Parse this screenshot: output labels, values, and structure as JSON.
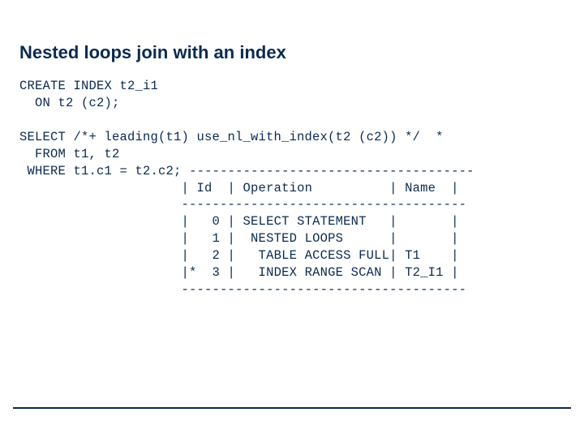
{
  "title": "Nested loops join with an index",
  "sql": {
    "line1": "CREATE INDEX t2_i1",
    "line2": "  ON t2 (c2);",
    "line3": "",
    "line4": "SELECT /*+ leading(t1) use_nl_with_index(t2 (c2)) */  *",
    "line5": "  FROM t1, t2",
    "line6": " WHERE t1.c1 = t2.c2;"
  },
  "plan": {
    "border": "-------------------------------------",
    "header": "| Id  | Operation          | Name  |",
    "r0": "|   0 | SELECT STATEMENT   |       |",
    "r1": "|   1 |  NESTED LOOPS      |       |",
    "r2": "|   2 |   TABLE ACCESS FULL| T1    |",
    "r3": "|*  3 |   INDEX RANGE SCAN | T2_I1 |"
  }
}
